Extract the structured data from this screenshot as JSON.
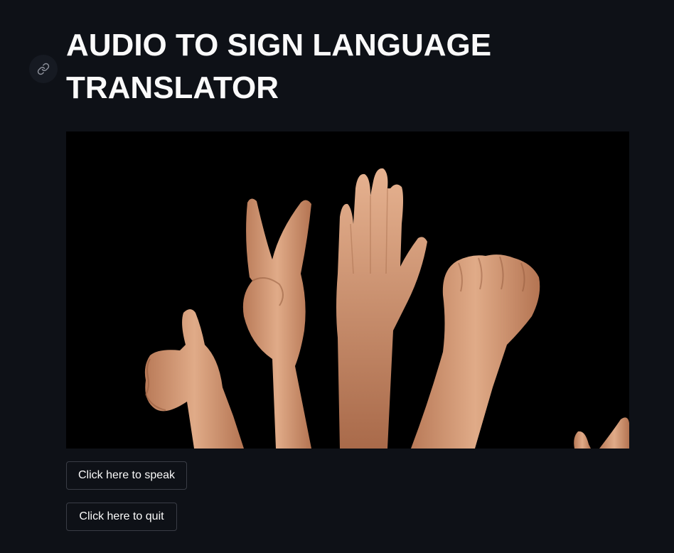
{
  "page": {
    "title": "AUDIO TO SIGN LANGUAGE TRANSLATOR",
    "anchor_icon": "link-icon",
    "background_color": "#0e1117",
    "text_color": "#fafafa"
  },
  "hero_image": {
    "alt": "Hands showing sign language gestures",
    "background_color": "#000000",
    "skin_color": "#d49a78"
  },
  "buttons": {
    "speak_label": "Click here to speak",
    "quit_label": "Click here to quit",
    "border_color": "#3a3d46"
  }
}
